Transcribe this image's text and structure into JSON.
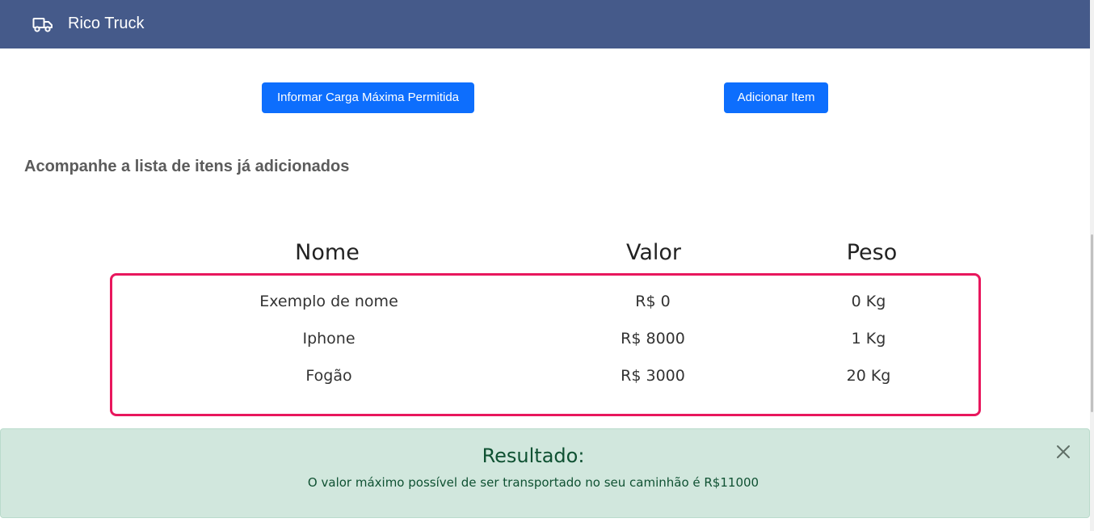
{
  "app": {
    "brand": "Rico Truck",
    "brand_icon": "truck-icon"
  },
  "actions": {
    "carga_label": "Informar Carga Máxima Permitida",
    "add_label": "Adicionar Item"
  },
  "list": {
    "title": "Acompanhe a lista de itens já adicionados",
    "columns": [
      "Nome",
      "Valor",
      "Peso"
    ],
    "rows": [
      {
        "nome": "Exemplo de nome",
        "valor": "R$ 0",
        "peso": "0 Kg"
      },
      {
        "nome": "Iphone",
        "valor": "R$ 8000",
        "peso": "1 Kg"
      },
      {
        "nome": "Fogão",
        "valor": "R$ 3000",
        "peso": "20 Kg"
      }
    ]
  },
  "result": {
    "heading": "Resultado:",
    "message": "O valor máximo possível de ser transportado no seu caminhão é R$11000",
    "close_icon": "close-icon"
  },
  "colors": {
    "navbar": "#455a8a",
    "primary": "#0d6efd",
    "table_border": "#e8175d",
    "alert_bg": "#d1e7dd",
    "alert_text": "#0f5132"
  }
}
